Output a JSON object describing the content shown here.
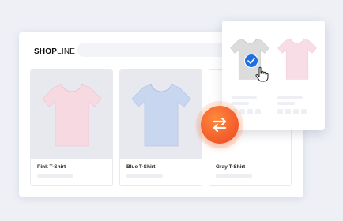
{
  "brand": {
    "logo_bold": "SHOP",
    "logo_regular": "LINE"
  },
  "products": [
    {
      "name": "Pink T-Shirt",
      "color": "#f6d9e1"
    },
    {
      "name": "Blue T-Shirt",
      "color": "#c8d6ef"
    },
    {
      "name": "Gray T-Shirt",
      "color": "#ffffff"
    }
  ],
  "variant_picker": {
    "options": [
      {
        "color": "#dcdcdc",
        "selected": true
      },
      {
        "color": "#f8dde6",
        "selected": false
      }
    ]
  },
  "colors": {
    "accent": "#f2592a",
    "selected_badge": "#1e6fe6"
  },
  "icons": [
    "swap-arrows-icon",
    "checkmark-icon",
    "hand-cursor-icon"
  ]
}
